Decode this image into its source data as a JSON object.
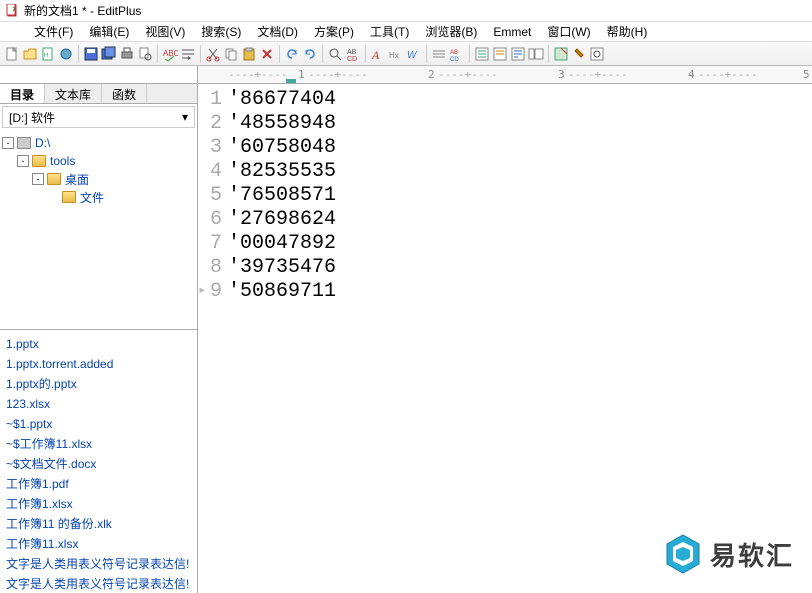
{
  "window": {
    "title": "新的文档1 * - EditPlus"
  },
  "menu": [
    "文件(F)",
    "编辑(E)",
    "视图(V)",
    "搜索(S)",
    "文档(D)",
    "方案(P)",
    "工具(T)",
    "浏览器(B)",
    "Emmet",
    "窗口(W)",
    "帮助(H)"
  ],
  "sidebar": {
    "tabs": [
      "目录",
      "文本库",
      "函数"
    ],
    "drive": "[D:] 软件",
    "tree": [
      {
        "indent": 0,
        "toggle": "-",
        "icon": "drive",
        "label": "D:\\"
      },
      {
        "indent": 1,
        "toggle": "-",
        "icon": "folder",
        "label": "tools"
      },
      {
        "indent": 2,
        "toggle": "-",
        "icon": "folder",
        "label": "桌面"
      },
      {
        "indent": 3,
        "toggle": "",
        "icon": "folder",
        "label": "文件"
      }
    ],
    "files": [
      "1.pptx",
      "1.pptx.torrent.added",
      "1.pptx的.pptx",
      "123.xlsx",
      "~$1.pptx",
      "~$工作簿11.xlsx",
      "~$文档文件.docx",
      "工作簿1.pdf",
      "工作簿1.xlsx",
      "工作簿11 的备份.xlk",
      "工作簿11.xlsx",
      "文字是人类用表义符号记录表达信!",
      "文字是人类用表义符号记录表达信!"
    ]
  },
  "editor": {
    "lines": [
      "'86677404",
      "'48558948",
      "'60758048",
      "'82535535",
      "'76508571",
      "'27698624",
      "'00047892",
      "'39735476",
      "'50869711"
    ]
  },
  "ruler": {
    "baseline": "----+----",
    "tick1": "1",
    "tick2": "2",
    "tick3": "3",
    "tick4": "4",
    "tick5": "5"
  },
  "watermark_text": "易软汇"
}
